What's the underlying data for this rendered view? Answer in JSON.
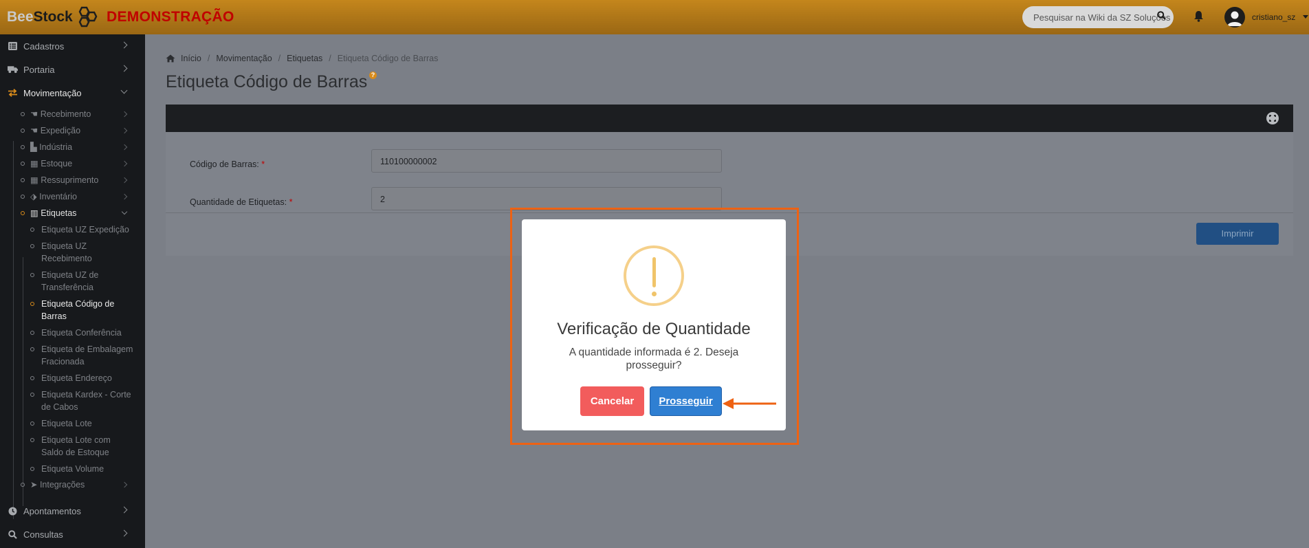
{
  "header": {
    "logo_bee": "Bee",
    "logo_stock": "Stock",
    "demo_label": "DEMONSTRAÇÃO",
    "search_placeholder": "Pesquisar na Wiki da SZ Soluções",
    "username": "cristiano_sz"
  },
  "sidebar": {
    "top_items": [
      {
        "label": "Cadastros",
        "icon": "list-icon"
      },
      {
        "label": "Portaria",
        "icon": "truck-icon"
      },
      {
        "label": "Movimentação",
        "icon": "exchange-icon"
      }
    ],
    "sub_items": [
      {
        "label": "Recebimento",
        "icon": "hand-icon"
      },
      {
        "label": "Expedição",
        "icon": "hand-icon"
      },
      {
        "label": "Indústria",
        "icon": "industry-icon"
      },
      {
        "label": "Estoque",
        "icon": "table-icon"
      },
      {
        "label": "Ressuprimento",
        "icon": "table-icon"
      },
      {
        "label": "Inventário",
        "icon": "tags-icon"
      },
      {
        "label": "Etiquetas",
        "icon": "barcode-icon"
      }
    ],
    "label_items": [
      "Etiqueta UZ Expedição",
      "Etiqueta UZ Recebimento",
      "Etiqueta UZ de Transferência",
      "Etiqueta Código de Barras",
      "Etiqueta Conferência",
      "Etiqueta de Embalagem Fracionada",
      "Etiqueta Endereço",
      "Etiqueta Kardex - Corte de Cabos",
      "Etiqueta Lote",
      "Etiqueta Lote com Saldo de Estoque",
      "Etiqueta Volume"
    ],
    "integrations": "Integrações",
    "bottom_items": [
      {
        "label": "Apontamentos",
        "icon": "clock-icon"
      },
      {
        "label": "Consultas",
        "icon": "search-icon"
      }
    ]
  },
  "breadcrumb": [
    "Início",
    "Movimentação",
    "Etiquetas",
    "Etiqueta Código de Barras"
  ],
  "page": {
    "title": "Etiqueta Código de Barras",
    "help": "?"
  },
  "form": {
    "barcode_label": "Código de Barras:",
    "barcode_value": "110100000002",
    "qty_label": "Quantidade de Etiquetas:",
    "qty_value": "2",
    "required_mark": "*",
    "print_button": "Imprimir"
  },
  "modal": {
    "title": "Verificação de Quantidade",
    "message": "A quantidade informada é 2. Deseja prosseguir?",
    "cancel": "Cancelar",
    "confirm": "Prosseguir"
  },
  "colors": {
    "topbar": "#c4861c",
    "accent": "#d88b1b",
    "highlight": "#ee6213",
    "confirm_button": "#2f7fd2",
    "cancel_button": "#f25c5c"
  }
}
